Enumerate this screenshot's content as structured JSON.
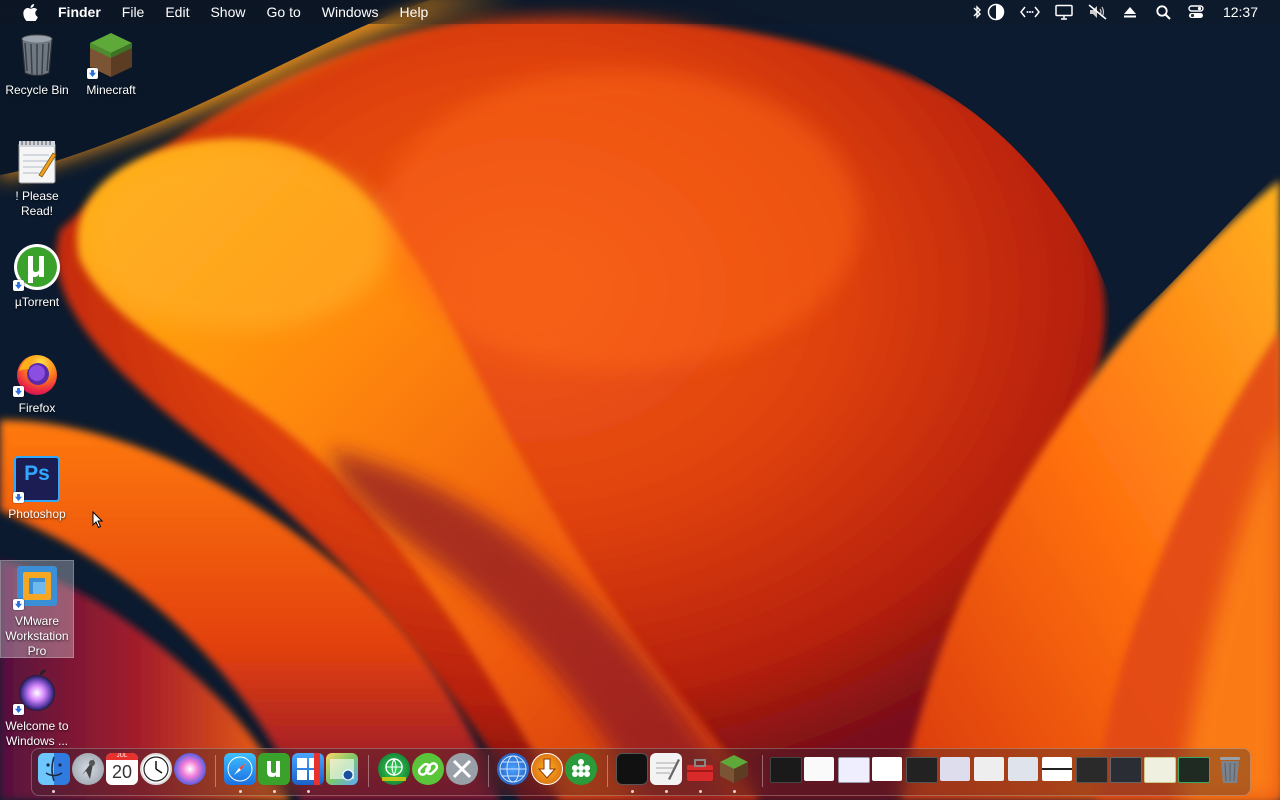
{
  "menubar": {
    "items": [
      "Finder",
      "File",
      "Edit",
      "Show",
      "Go to",
      "Windows",
      "Help"
    ],
    "status_icons": [
      "bluetooth-icon",
      "contrast-icon",
      "code-icon",
      "display-icon",
      "mute-icon",
      "eject-icon",
      "search-icon",
      "control-center-icon"
    ],
    "clock": "12:37"
  },
  "desktop_icons": [
    {
      "label": "Recycle Bin",
      "icon": "recycle-bin-icon"
    },
    {
      "label": "Minecraft",
      "icon": "minecraft-icon"
    },
    {
      "label": "! Please Read!",
      "icon": "notepad-icon"
    },
    {
      "label": "µTorrent",
      "icon": "utorrent-icon"
    },
    {
      "label": "Firefox",
      "icon": "firefox-icon"
    },
    {
      "label": "Photoshop",
      "icon": "photoshop-icon"
    },
    {
      "label": "VMware Workstation Pro",
      "icon": "vmware-icon"
    },
    {
      "label": "Welcome to Windows ...",
      "icon": "welcome-icon"
    }
  ],
  "dock": {
    "calendar_day": "20",
    "calendar_month": "JUL",
    "photoshop_abbr": "Ps"
  },
  "colors": {
    "accent": "#ff6a00",
    "wallpaper_dark": "#0b1a2e"
  }
}
